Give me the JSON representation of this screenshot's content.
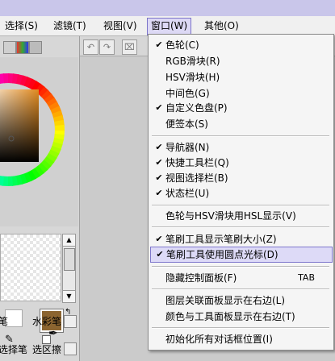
{
  "menubar": {
    "items": [
      {
        "label": "选择(S)"
      },
      {
        "label": "滤镜(T)"
      },
      {
        "label": "视图(V)"
      },
      {
        "label": "窗口(W)"
      },
      {
        "label": "其他(O)"
      }
    ]
  },
  "left_panel": {
    "tool_labels": [
      "笔",
      "水彩笔",
      "选择笔",
      "选区擦"
    ]
  },
  "colors": {
    "main_swatch": "#8b6430",
    "menu_highlight": "#dddaf7",
    "title_strip": "#c9c6ea"
  },
  "window_menu": {
    "items": [
      {
        "label": "色轮(C)",
        "checked": true
      },
      {
        "label": "RGB滑块(R)",
        "checked": false
      },
      {
        "label": "HSV滑块(H)",
        "checked": false
      },
      {
        "label": "中间色(G)",
        "checked": false
      },
      {
        "label": "自定义色盘(P)",
        "checked": true
      },
      {
        "label": "便签本(S)",
        "checked": false
      },
      {
        "label": "导航器(N)",
        "checked": true
      },
      {
        "label": "快捷工具栏(Q)",
        "checked": true
      },
      {
        "label": "视图选择栏(B)",
        "checked": true
      },
      {
        "label": "状态栏(U)",
        "checked": true
      },
      {
        "label": "色轮与HSV滑块用HSL显示(V)",
        "checked": false
      },
      {
        "label": "笔刷工具显示笔刷大小(Z)",
        "checked": true
      },
      {
        "label": "笔刷工具使用圆点光标(D)",
        "checked": true,
        "highlighted": true
      },
      {
        "label": "隐藏控制面板(F)",
        "checked": false,
        "shortcut": "TAB"
      },
      {
        "label": "图层关联面板显示在右边(L)",
        "checked": false
      },
      {
        "label": "颜色与工具面板显示在右边(T)",
        "checked": false
      },
      {
        "label": "初始化所有对话框位置(I)",
        "checked": false
      }
    ],
    "checkmark": "✔"
  }
}
